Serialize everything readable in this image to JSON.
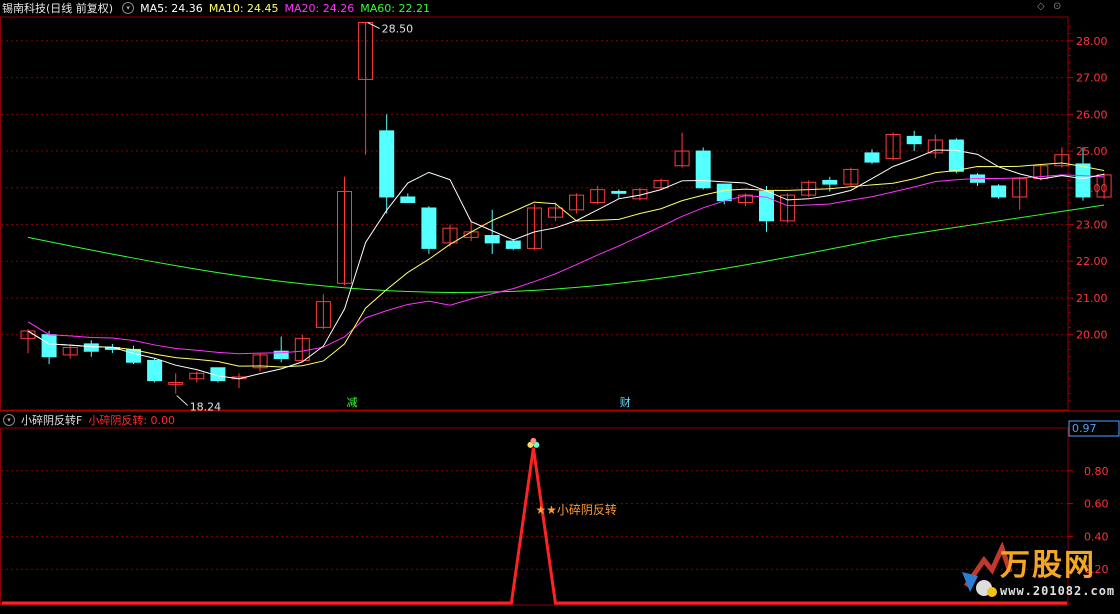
{
  "header": {
    "stock_name": "锡南科技(日线 前复权)",
    "ma5": "MA5: 24.36",
    "ma10": "MA10: 24.45",
    "ma20": "MA20: 24.26",
    "ma60": "MA60: 22.21"
  },
  "colors": {
    "up": "#ff3b3b",
    "down": "#54ffff",
    "ma5": "#ffffff",
    "ma10": "#ffff66",
    "ma20": "#ff33ff",
    "ma60": "#33ff33",
    "grid": "#8b0000",
    "indicator": "#ff2222"
  },
  "price_axis": {
    "ticks": [
      "28.00",
      "27.00",
      "26.00",
      "25.00",
      "24.00",
      "23.00",
      "22.00",
      "21.00",
      "20.00"
    ],
    "max_label": "28.50",
    "min_label": "18.24",
    "markers": [
      "减",
      "财"
    ]
  },
  "candles": [
    [
      19.9,
      20.1,
      19.5,
      20.15
    ],
    [
      20.0,
      19.4,
      19.2,
      20.1
    ],
    [
      19.45,
      19.65,
      19.35,
      19.7
    ],
    [
      19.75,
      19.55,
      19.4,
      19.85
    ],
    [
      19.65,
      19.6,
      19.5,
      19.75
    ],
    [
      19.6,
      19.25,
      19.2,
      19.7
    ],
    [
      19.3,
      18.75,
      18.7,
      19.35
    ],
    [
      18.65,
      18.7,
      18.4,
      18.95
    ],
    [
      18.8,
      18.95,
      18.7,
      19.0
    ],
    [
      19.1,
      18.75,
      18.7,
      19.1
    ],
    [
      18.8,
      18.85,
      18.55,
      18.95
    ],
    [
      19.1,
      19.45,
      19.0,
      19.5
    ],
    [
      19.55,
      19.35,
      19.25,
      19.95
    ],
    [
      19.3,
      19.9,
      19.25,
      20.0
    ],
    [
      20.2,
      20.9,
      20.15,
      21.1
    ],
    [
      21.4,
      23.9,
      21.35,
      24.3
    ],
    [
      26.95,
      28.5,
      24.9,
      28.5
    ],
    [
      25.55,
      23.75,
      23.3,
      26.0
    ],
    [
      23.75,
      23.6,
      23.6,
      23.85
    ],
    [
      23.45,
      22.35,
      22.2,
      23.5
    ],
    [
      22.5,
      22.9,
      22.4,
      23.0
    ],
    [
      22.65,
      22.8,
      22.55,
      23.1
    ],
    [
      22.7,
      22.5,
      22.2,
      23.4
    ],
    [
      22.55,
      22.35,
      22.3,
      22.6
    ],
    [
      22.35,
      23.45,
      22.3,
      23.55
    ],
    [
      23.2,
      23.45,
      23.1,
      23.6
    ],
    [
      23.4,
      23.8,
      23.3,
      23.85
    ],
    [
      23.6,
      23.95,
      23.55,
      24.05
    ],
    [
      23.9,
      23.85,
      23.7,
      23.95
    ],
    [
      23.7,
      23.95,
      23.65,
      24.0
    ],
    [
      24.0,
      24.2,
      23.95,
      24.25
    ],
    [
      24.6,
      25.0,
      24.55,
      25.5
    ],
    [
      25.0,
      24.0,
      23.95,
      25.1
    ],
    [
      24.1,
      23.65,
      23.55,
      24.1
    ],
    [
      23.6,
      23.8,
      23.5,
      23.85
    ],
    [
      23.9,
      23.1,
      22.8,
      24.05
    ],
    [
      23.1,
      23.8,
      23.05,
      23.85
    ],
    [
      23.8,
      24.15,
      23.75,
      24.2
    ],
    [
      24.2,
      24.1,
      23.9,
      24.3
    ],
    [
      24.1,
      24.5,
      24.05,
      24.55
    ],
    [
      24.95,
      24.7,
      24.65,
      25.05
    ],
    [
      24.8,
      25.45,
      24.75,
      25.5
    ],
    [
      25.4,
      25.2,
      25.0,
      25.55
    ],
    [
      24.95,
      25.3,
      24.8,
      25.45
    ],
    [
      25.3,
      24.45,
      24.4,
      25.35
    ],
    [
      24.35,
      24.15,
      24.05,
      24.4
    ],
    [
      24.05,
      23.75,
      23.7,
      24.1
    ],
    [
      23.75,
      24.25,
      23.4,
      24.3
    ],
    [
      24.25,
      24.6,
      24.2,
      24.65
    ],
    [
      24.6,
      24.9,
      24.55,
      25.1
    ],
    [
      24.65,
      23.75,
      23.65,
      25.1
    ],
    [
      23.75,
      24.35,
      23.7,
      24.4
    ]
  ],
  "indicator": {
    "title": "小碎阴反转F",
    "label": "小碎阴反转: 0.00",
    "signal_text": "★★小碎阴反转",
    "current_value": "0.97",
    "ticks": [
      "0.80",
      "0.60",
      "0.40",
      "0.20"
    ]
  },
  "watermark": {
    "brand": "万股网",
    "url": "www.201082.com"
  }
}
